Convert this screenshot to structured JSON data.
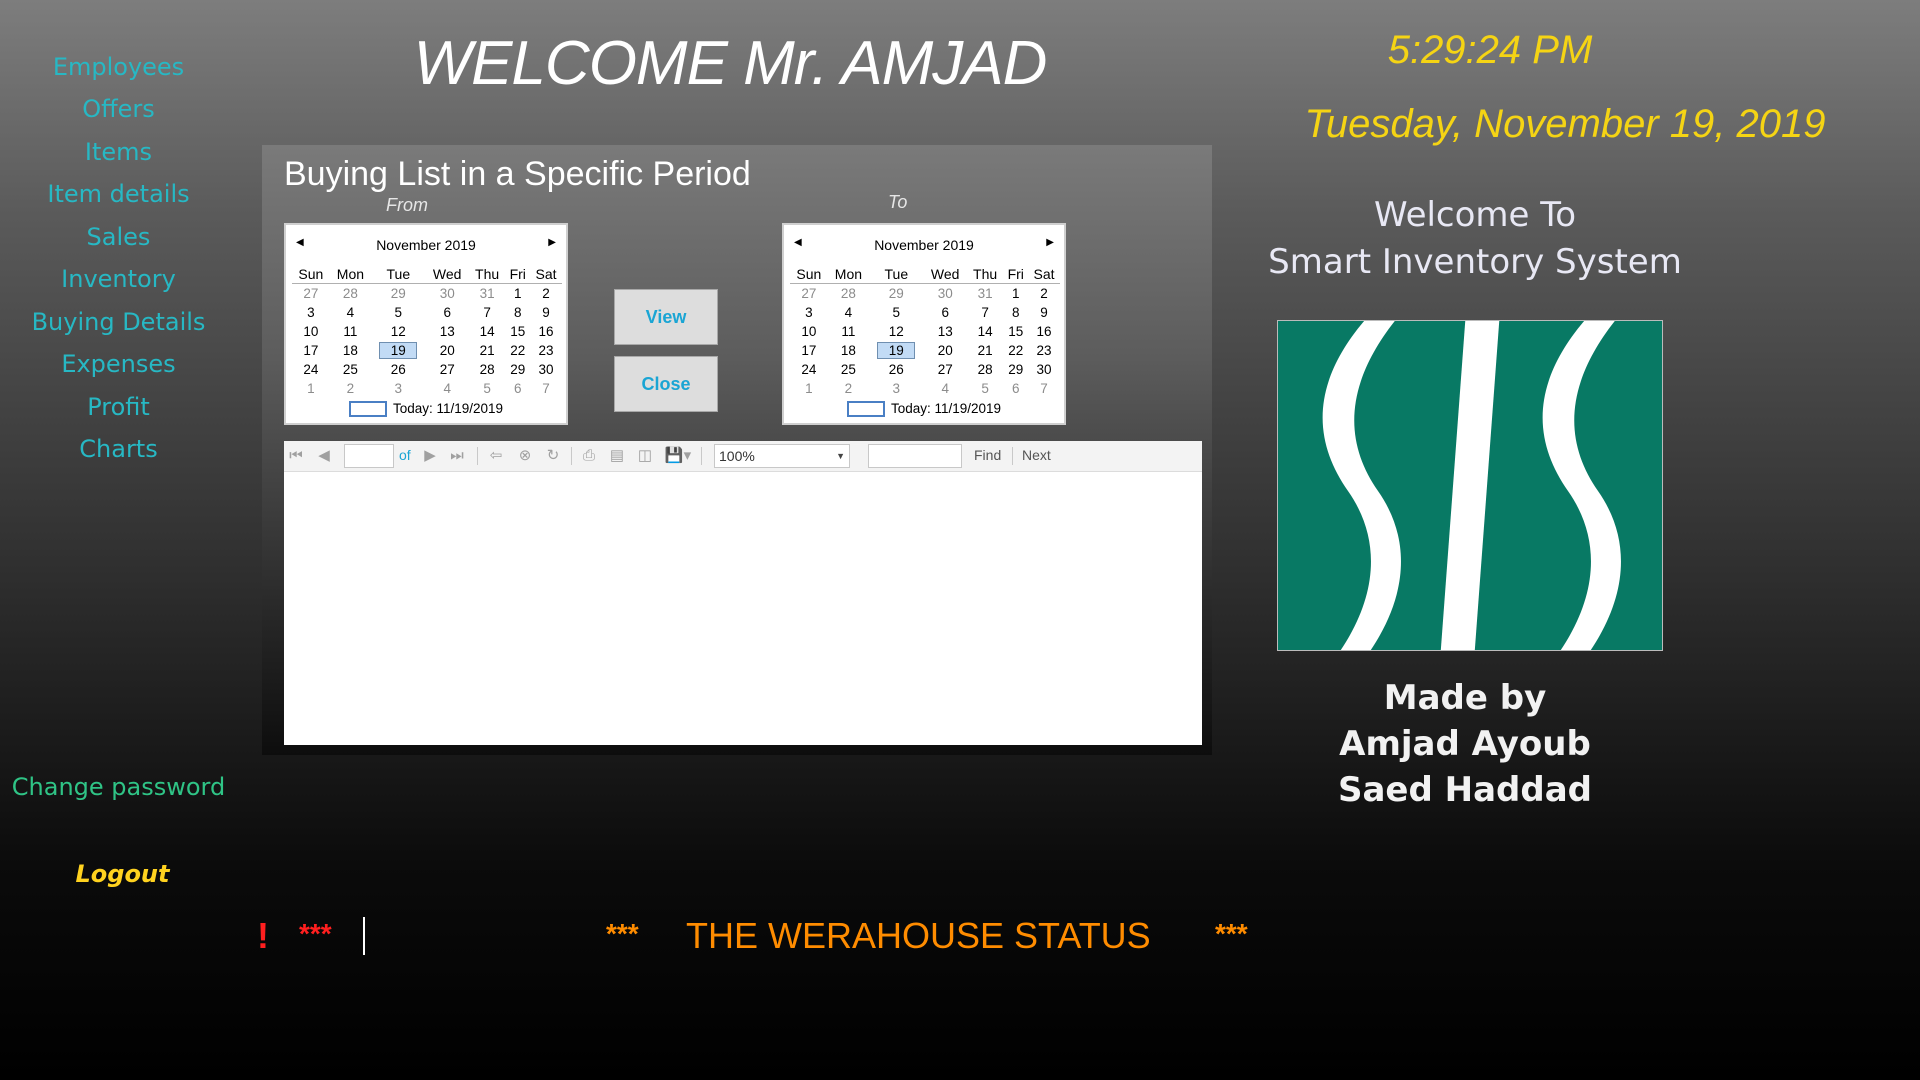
{
  "sidebar": {
    "items": [
      {
        "label": "Employees"
      },
      {
        "label": "Offers"
      },
      {
        "label": "Items"
      },
      {
        "label": "Item details"
      },
      {
        "label": "Sales"
      },
      {
        "label": "Inventory"
      },
      {
        "label": "Buying Details"
      },
      {
        "label": "Expenses"
      },
      {
        "label": "Profit"
      },
      {
        "label": "Charts"
      }
    ],
    "change_password": "Change password",
    "logout": "Logout"
  },
  "header": {
    "welcome": "WELCOME Mr. AMJAD",
    "time": "5:29:24 PM",
    "date": "Tuesday, November 19, 2019"
  },
  "right": {
    "welcome_line1": "Welcome To",
    "welcome_line2": "Smart Inventory System",
    "made_by": "Made by",
    "author1": "Amjad Ayoub",
    "author2": "Saed Haddad"
  },
  "panel": {
    "title": "Buying List in a Specific Period",
    "from_label": "From",
    "to_label": "To",
    "view_button": "View",
    "close_button": "Close"
  },
  "calendar": {
    "month": "November 2019",
    "days_of_week": [
      "Sun",
      "Mon",
      "Tue",
      "Wed",
      "Thu",
      "Fri",
      "Sat"
    ],
    "weeks": [
      [
        "27",
        "28",
        "29",
        "30",
        "31",
        "1",
        "2"
      ],
      [
        "3",
        "4",
        "5",
        "6",
        "7",
        "8",
        "9"
      ],
      [
        "10",
        "11",
        "12",
        "13",
        "14",
        "15",
        "16"
      ],
      [
        "17",
        "18",
        "19",
        "20",
        "21",
        "22",
        "23"
      ],
      [
        "24",
        "25",
        "26",
        "27",
        "28",
        "29",
        "30"
      ],
      [
        "1",
        "2",
        "3",
        "4",
        "5",
        "6",
        "7"
      ]
    ],
    "selected": "19",
    "today_text": "Today: 11/19/2019"
  },
  "report_toolbar": {
    "of_label": "of",
    "zoom_value": "100%",
    "find_label": "Find",
    "next_label": "Next"
  },
  "status_bar": {
    "warning_mark": "!",
    "warning_stars": "***",
    "stars_left": "***",
    "message": "THE WERAHOUSE STATUS",
    "stars_right": "***"
  },
  "colors": {
    "nav": "#27b8c4",
    "clock": "#f5d414",
    "logo_bg": "#087964",
    "status_text": "#ff8c00",
    "warning": "#ff1f1f"
  }
}
